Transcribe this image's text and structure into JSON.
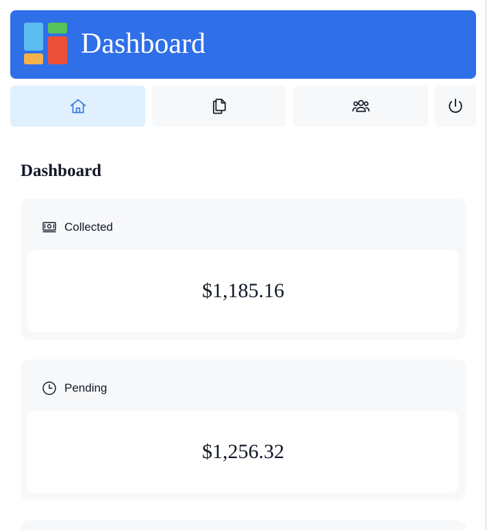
{
  "header": {
    "app_title": "Dashboard",
    "logo_colors": [
      "#5bbcf0",
      "#56c25a",
      "#f6b24a",
      "#ec5137"
    ],
    "background_color": "#2f6fe8"
  },
  "nav": {
    "tabs": [
      {
        "icon": "home-icon",
        "active": true
      },
      {
        "icon": "documents-icon",
        "active": false
      },
      {
        "icon": "users-icon",
        "active": false
      },
      {
        "icon": "power-icon",
        "active": false
      }
    ]
  },
  "main": {
    "title": "Dashboard",
    "cards": [
      {
        "label": "Collected",
        "icon": "banknote-icon",
        "value": "$1,185.16"
      },
      {
        "label": "Pending",
        "icon": "clock-icon",
        "value": "$1,256.32"
      }
    ]
  },
  "colors": {
    "accent": "#2f6fe8",
    "active_tab": "#e0f0fe",
    "card_bg": "#f7f8fa"
  }
}
